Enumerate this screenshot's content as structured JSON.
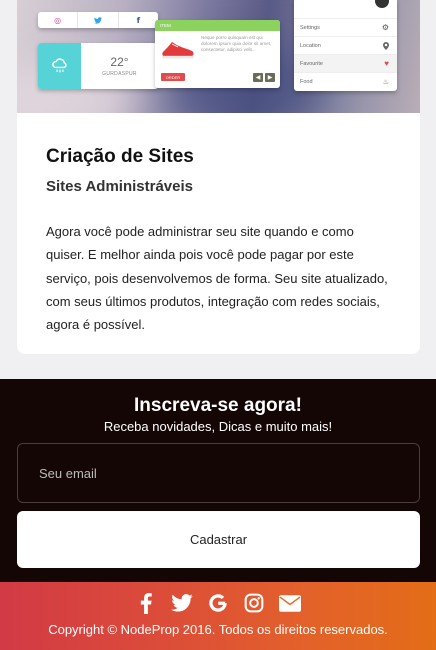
{
  "card": {
    "title": "Criação de Sites",
    "subtitle": "Sites Administráveis",
    "body": "Agora você pode administrar seu site quando e como quiser. E melhor ainda pois você pode pagar por este serviço, pois desenvolvemos de forma. Seu site atualizado, com seus últimos produtos, integração com redes sociais, agora é possível."
  },
  "hero": {
    "weather": {
      "temp": "22°",
      "city": "GURDASPUR"
    },
    "item": {
      "header": "ITEM",
      "desc": "Neque porro quisquam est qui dolorem ipsum quia dolor sit amet, consectetur, adipisci velit...",
      "order": "ORDER",
      "prev": "◀",
      "next": "▶"
    },
    "menu": [
      "Settings",
      "Location",
      "Favourite",
      "Food"
    ]
  },
  "newsletter": {
    "title": "Inscreva-se agora!",
    "subtitle": "Receba novidades, Dicas e muito mais!",
    "email_placeholder": "Seu email",
    "button": "Cadastrar"
  },
  "footer": {
    "icons": [
      "facebook-icon",
      "twitter-icon",
      "google-icon",
      "instagram-icon",
      "envelope-icon"
    ],
    "copyright": "Copyright © NodeProp 2016. Todos os direitos reservados."
  },
  "colors": {
    "newsletter_bg": "#130605",
    "footer_start": "#d23a45",
    "footer_end": "#e36d17",
    "weather_accent": "#55d3d6",
    "item_accent": "#8bd25f",
    "order_red": "#e24b4b"
  }
}
